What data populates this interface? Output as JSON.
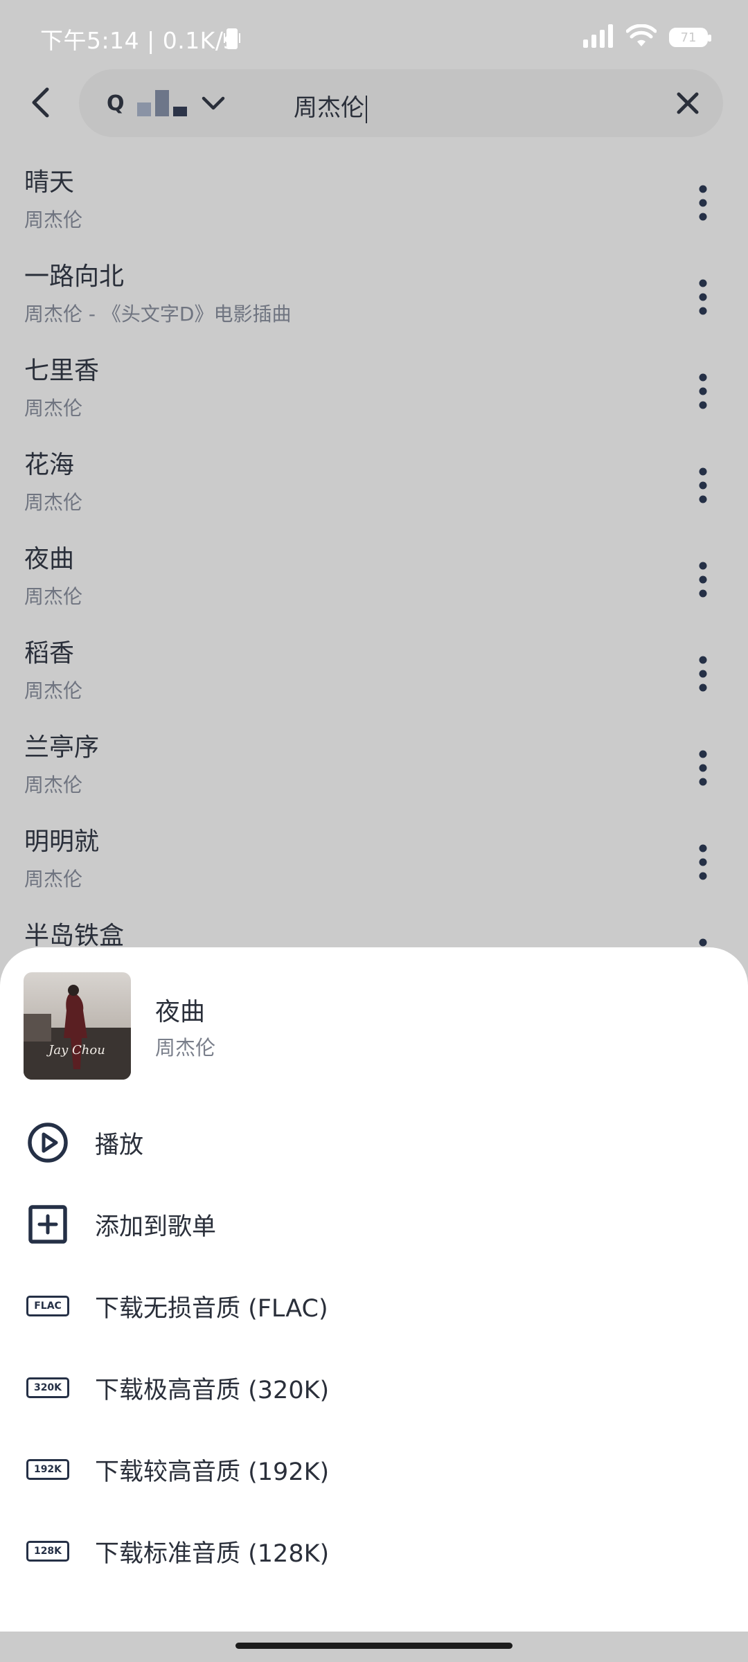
{
  "status_bar": {
    "time_speed": "下午5:14 | 0.1K/s",
    "battery_level": "71",
    "icons": [
      "phone-vibrate-icon",
      "signal-icon",
      "wifi-icon",
      "battery-icon"
    ]
  },
  "search": {
    "source_letter": "Q",
    "query": "周杰伦",
    "back_icon": "back-arrow-icon",
    "dropdown_icon": "chevron-down-icon",
    "clear_icon": "close-icon"
  },
  "songs": [
    {
      "title": "晴天",
      "artist": "周杰伦"
    },
    {
      "title": "一路向北",
      "artist": "周杰伦 - 《头文字D》电影插曲"
    },
    {
      "title": "七里香",
      "artist": "周杰伦"
    },
    {
      "title": "花海",
      "artist": "周杰伦"
    },
    {
      "title": "夜曲",
      "artist": "周杰伦"
    },
    {
      "title": "稻香",
      "artist": "周杰伦"
    },
    {
      "title": "兰亭序",
      "artist": "周杰伦"
    },
    {
      "title": "明明就",
      "artist": "周杰伦"
    },
    {
      "title": "半岛铁盒",
      "artist": ""
    }
  ],
  "sheet": {
    "title": "夜曲",
    "artist": "周杰伦",
    "cover_text": "Jay Chou",
    "actions": [
      {
        "label": "播放",
        "icon": "play-circle-icon"
      },
      {
        "label": "添加到歌单",
        "icon": "add-square-icon"
      },
      {
        "label": "下载无损音质 (FLAC)",
        "icon": "flac-badge-icon",
        "badge": "FLAC"
      },
      {
        "label": "下载极高音质 (320K)",
        "icon": "320k-badge-icon",
        "badge": "320K"
      },
      {
        "label": "下载较高音质 (192K)",
        "icon": "192k-badge-icon",
        "badge": "192K"
      },
      {
        "label": "下载标准音质 (128K)",
        "icon": "128k-badge-icon",
        "badge": "128K"
      }
    ]
  },
  "colors": {
    "scrim_bg": "#cbcbcb",
    "primary_text": "#2a2f3a",
    "secondary_text": "#6f7480",
    "icon_dark": "#253046",
    "sheet_bg": "#ffffff"
  }
}
